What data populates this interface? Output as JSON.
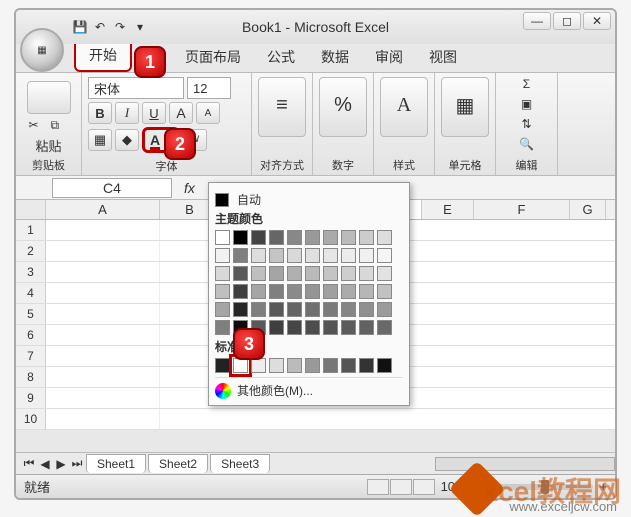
{
  "title": "Book1 - Microsoft Excel",
  "tabs": {
    "home": "开始",
    "insert": "入",
    "page_layout": "页面布局",
    "formulas": "公式",
    "data": "数据",
    "review": "审阅",
    "view": "视图"
  },
  "ribbon": {
    "clipboard": {
      "paste": "粘贴",
      "label": "剪贴板"
    },
    "font": {
      "name": "宋体",
      "size": "12",
      "bold": "B",
      "italic": "I",
      "underline": "U",
      "grow": "A",
      "shrink": "A",
      "label": "字体"
    },
    "alignment": {
      "label": "对齐方式"
    },
    "number": {
      "label": "数字"
    },
    "styles": {
      "label": "样式"
    },
    "cells": {
      "label": "单元格"
    },
    "editing": {
      "label": "编辑"
    }
  },
  "namebox": "C4",
  "fx": "fx",
  "columns": [
    "A",
    "B",
    "E",
    "F",
    "G"
  ],
  "rows": [
    "1",
    "2",
    "3",
    "4",
    "5",
    "6",
    "7",
    "8",
    "9",
    "10"
  ],
  "color_picker": {
    "auto": "自动",
    "theme": "主题颜色",
    "standard": "标准",
    "more": "其他颜色(M)..."
  },
  "sheets": [
    "Sheet1",
    "Sheet2",
    "Sheet3"
  ],
  "status": {
    "ready": "就绪",
    "zoom": "100%"
  },
  "callouts": {
    "c1": "1",
    "c2": "2",
    "c3": "3"
  },
  "watermark": {
    "main": "xcel教程网",
    "sub": "www.exceljcw.com"
  }
}
